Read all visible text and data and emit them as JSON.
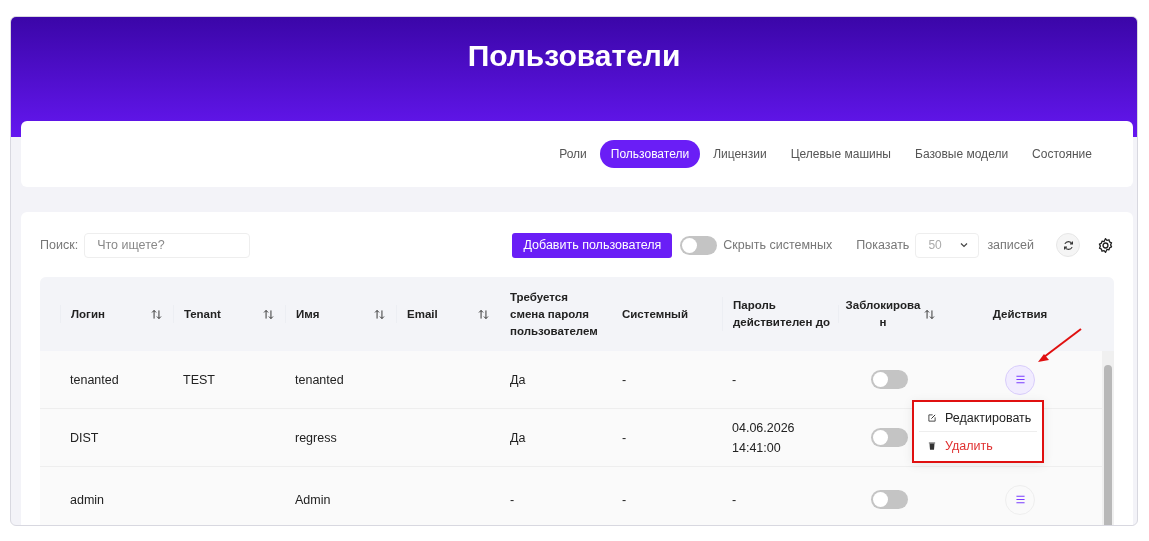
{
  "page_title": "Пользователи",
  "tabs": [
    {
      "label": "Роли",
      "selected": false
    },
    {
      "label": "Пользователи",
      "selected": true
    },
    {
      "label": "Лицензии",
      "selected": false
    },
    {
      "label": "Целевые машины",
      "selected": false
    },
    {
      "label": "Базовые модели",
      "selected": false
    },
    {
      "label": "Состояние",
      "selected": false
    }
  ],
  "toolbar": {
    "search_label": "Поиск:",
    "search": {
      "placeholder": "Что ищете?"
    },
    "add_button": "Добавить пользователя",
    "hide_system": {
      "label": "Скрыть системных",
      "on": false
    },
    "show_label": "Показать",
    "page_size": "50",
    "records_label": "записей"
  },
  "table": {
    "columns": [
      {
        "label": "Логин",
        "sortable": true
      },
      {
        "label": "Tenant",
        "sortable": true
      },
      {
        "label": "Имя",
        "sortable": true
      },
      {
        "label": "Email",
        "sortable": true
      },
      {
        "label": "Требуется смена пароля пользователем",
        "sortable": false
      },
      {
        "label": "Системный",
        "sortable": false
      },
      {
        "label": "Пароль действителен до",
        "sortable": false
      },
      {
        "label": "Заблокирова н",
        "sortable": true
      },
      {
        "label": "Действия",
        "sortable": false
      }
    ],
    "rows": [
      {
        "login": "tenanted",
        "tenant": "TEST",
        "name": "tenanted",
        "password_change": "Да",
        "system": "-",
        "password_valid": "-",
        "blocked": false,
        "menu_open": true
      },
      {
        "login": "DIST",
        "tenant": "",
        "name": "regress",
        "password_change": "Да",
        "system": "-",
        "password_valid": "04.06.2026 14:41:00",
        "blocked": false
      },
      {
        "login": "admin",
        "tenant": "",
        "name": "Admin",
        "password_change": "-",
        "system": "-",
        "password_valid": "-",
        "blocked": false,
        "menu_open": false
      }
    ]
  },
  "action_menu": [
    {
      "label": "Редактировать",
      "kind": "edit"
    },
    {
      "label": "Удалить",
      "kind": "delete"
    }
  ]
}
